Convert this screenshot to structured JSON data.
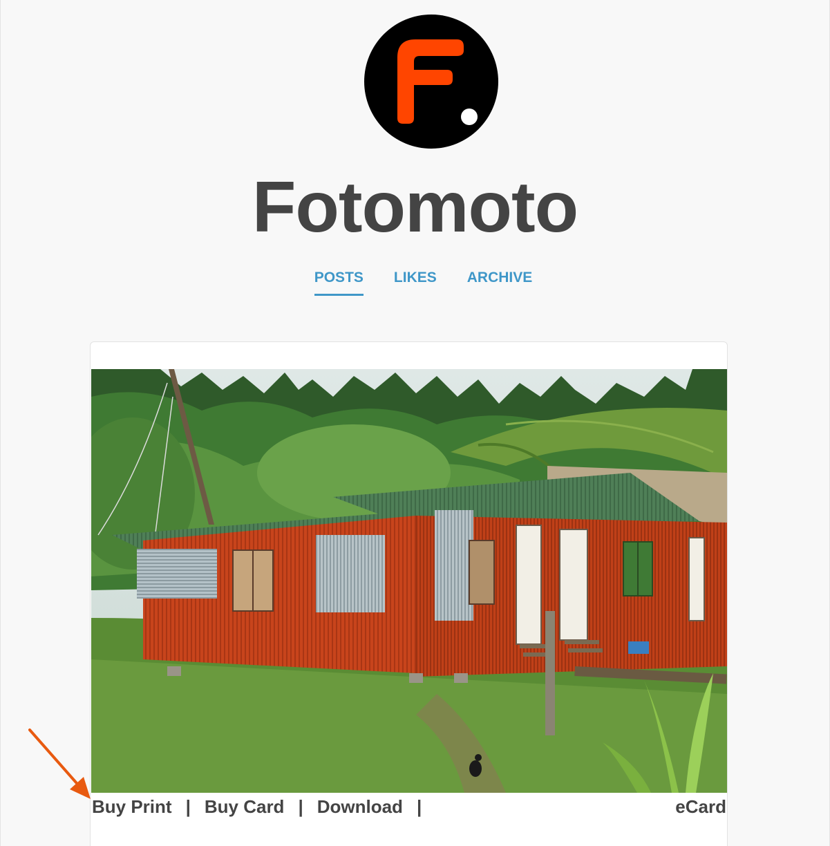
{
  "header": {
    "logo_icon": "fotomoto-logo-icon",
    "title": "Fotomoto"
  },
  "nav": {
    "items": [
      {
        "label": "POSTS",
        "active": true
      },
      {
        "label": "LIKES",
        "active": false
      },
      {
        "label": "ARCHIVE",
        "active": false
      }
    ]
  },
  "post": {
    "photo_icon": "photo-red-corrugated-house",
    "actions": {
      "buy_print": "Buy Print",
      "buy_card": "Buy Card",
      "download": "Download",
      "separator": "|",
      "ecard": "eCard"
    }
  },
  "annotation": {
    "arrow_icon": "orange-arrow-icon",
    "color": "#e85a10"
  },
  "colors": {
    "accent": "#3f97c8",
    "logo_orange": "#ff4500",
    "title_text": "#444444"
  }
}
